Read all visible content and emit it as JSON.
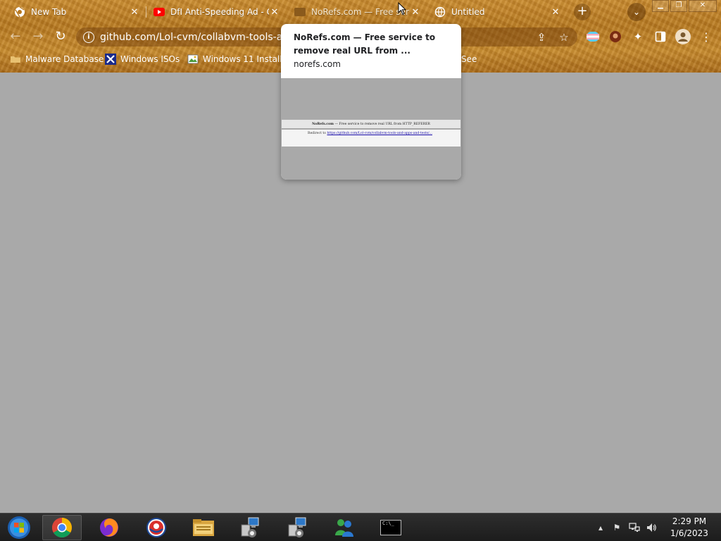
{
  "browser": {
    "tabs": [
      {
        "title": "New Tab",
        "favicon": "chrome-icon",
        "active": false
      },
      {
        "title": "DfI Anti-Speeding Ad - C",
        "favicon": "youtube-icon",
        "active": false
      },
      {
        "title": "NoRefs.com — Free ser",
        "favicon": "page-icon",
        "active": true
      },
      {
        "title": "Untitled",
        "favicon": "globe-icon",
        "active": false
      }
    ],
    "new_tab_symbol": "+",
    "tab_search_symbol": "⌄",
    "address_bar": {
      "url": "github.com/Lol-cvm/collabvm-tools-and"
    },
    "bookmarks": [
      {
        "label": "Malware Database",
        "icon": "folder-icon"
      },
      {
        "label": "Windows ISOs",
        "icon": "x-icon"
      },
      {
        "label": "Windows 11 Installer",
        "icon": "image-icon"
      },
      {
        "label": "See",
        "icon": "none"
      }
    ]
  },
  "hover_card": {
    "title": "NoRefs.com — Free service to remove real URL from ...",
    "domain": "norefs.com",
    "preview": {
      "header_site": "NoRefs.com",
      "header_text": "— Free service to remove real URL from HTTP_REFERER",
      "redirect_label": "Redirect to",
      "redirect_url": "https://github.com/Lol-cvm/collabvm-tools-and-apps-and-tests/..."
    }
  },
  "taskbar": {
    "apps": [
      "start-orb-icon",
      "chrome-icon",
      "firefox-icon",
      "opera-icon",
      "file-explorer-icon",
      "network-setup-icon",
      "network-setup-icon",
      "messenger-icon",
      "command-prompt-icon"
    ],
    "cmd_label": "C:\\_",
    "clock": {
      "time": "2:29 PM",
      "date": "1/6/2023"
    },
    "tray": [
      "show-hidden-icons",
      "action-center-flag-icon",
      "network-icon",
      "volume-icon"
    ]
  },
  "colors": {
    "page_background": "#a9a9a9",
    "theme_gold": "#c98a2e",
    "taskbar": "#1c1c1c"
  }
}
